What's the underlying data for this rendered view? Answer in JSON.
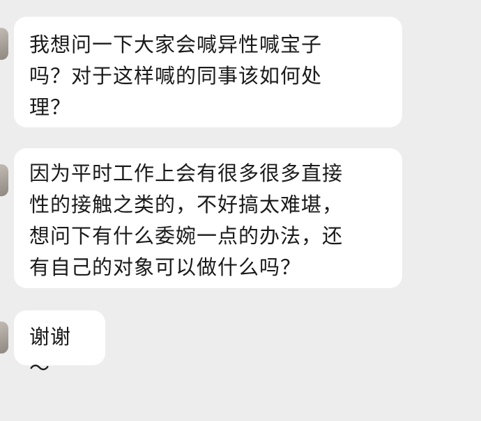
{
  "messages": [
    {
      "text": "我想问一下大家会喊异性喊宝子\n吗？对于这样喊的同事该如何处\n理？"
    },
    {
      "text": "因为平时工作上会有很多很多直接\n性的接触之类的，不好搞太难堪，\n想问下有什么委婉一点的办法，还\n有自己的对象可以做什么吗？"
    },
    {
      "text": "谢谢～"
    }
  ]
}
